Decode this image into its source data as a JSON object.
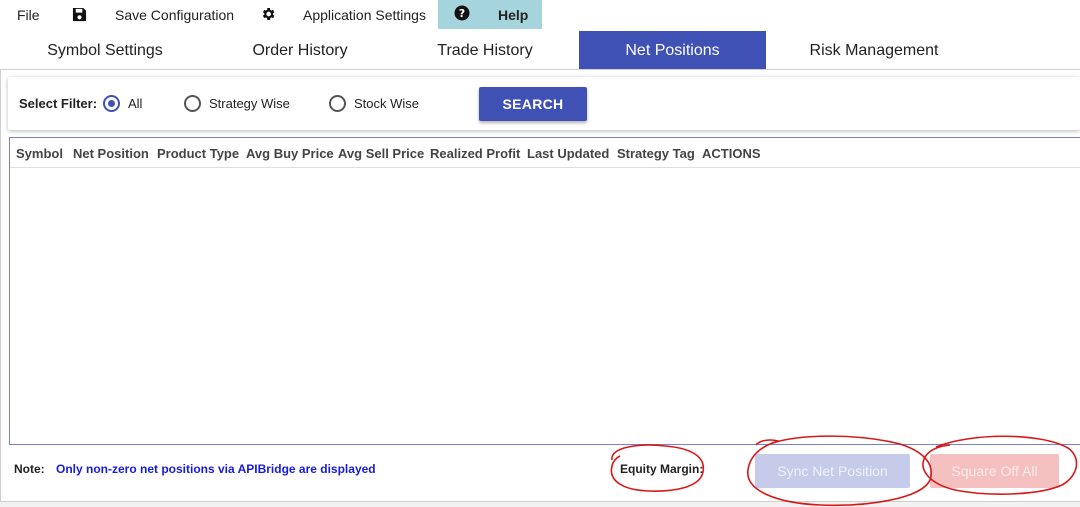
{
  "menu": {
    "file": "File",
    "save_configuration": "Save Configuration",
    "application_settings": "Application Settings",
    "help": "Help",
    "icons": {
      "save": "floppy-disk-icon",
      "settings": "gear-icon",
      "help": "question-circle-icon"
    }
  },
  "tabs": [
    {
      "label": "Symbol Settings",
      "active": false
    },
    {
      "label": "Order History",
      "active": false
    },
    {
      "label": "Trade History",
      "active": false
    },
    {
      "label": "Net Positions",
      "active": true
    },
    {
      "label": "Risk Management",
      "active": false
    }
  ],
  "filter": {
    "label": "Select Filter:",
    "options": [
      {
        "label": "All",
        "checked": true
      },
      {
        "label": "Strategy Wise",
        "checked": false
      },
      {
        "label": "Stock Wise",
        "checked": false
      }
    ],
    "search_label": "SEARCH"
  },
  "table": {
    "columns": [
      "Symbol",
      "Net Position",
      "Product Type",
      "Avg Buy Price",
      "Avg Sell Price",
      "Realized Profit",
      "Last Updated",
      "Strategy Tag",
      "ACTIONS"
    ],
    "rows": []
  },
  "footer": {
    "note_label": "Note:",
    "note_text": "Only non-zero net positions via APIBridge are displayed",
    "equity_margin_label": "Equity Margin:",
    "sync_button": "Sync Net Position",
    "square_off_button": "Square Off All"
  },
  "colors": {
    "primary": "#3f51b5",
    "help_bg": "#a6d4dc",
    "note_text": "#1a1adb",
    "sync_disabled": "#c6cbe9",
    "square_off_disabled": "#f4c0c0",
    "annotation": "#d81818"
  }
}
